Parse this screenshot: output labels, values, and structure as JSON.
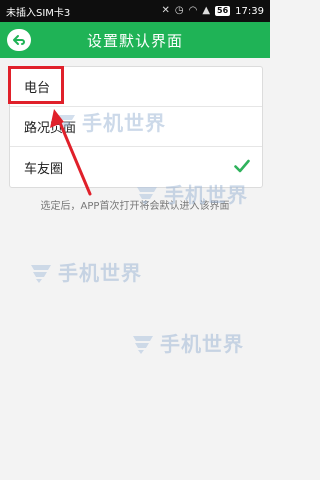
{
  "status_bar": {
    "carrier": "未插入SIM卡3",
    "battery": "56",
    "time": "17:39"
  },
  "header": {
    "title": "设置默认界面",
    "back_icon": "back-arrow-icon"
  },
  "options": [
    {
      "label": "电台",
      "selected": false
    },
    {
      "label": "路况页面",
      "selected": false
    },
    {
      "label": "车友圈",
      "selected": true
    }
  ],
  "hint": "选定后，APP首次打开将会默认进入该界面",
  "watermark": "手机世界",
  "colors": {
    "header": "#1fb356",
    "check": "#2fb25c",
    "highlight": "#e0202a"
  }
}
